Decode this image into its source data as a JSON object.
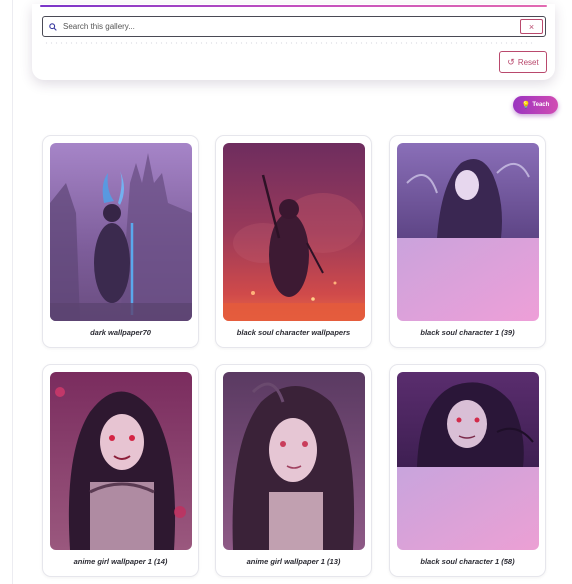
{
  "search": {
    "placeholder": "Search this gallery...",
    "clear_label": "×",
    "reset_label": "Reset"
  },
  "fab": {
    "label": "Teach"
  },
  "gallery": {
    "items": [
      {
        "caption": "dark wallpaper70"
      },
      {
        "caption": "black soul character wallpapers"
      },
      {
        "caption": "black soul character 1 (39)"
      },
      {
        "caption": "anime girl wallpaper 1 (14)"
      },
      {
        "caption": "anime girl wallpaper 1 (13)"
      },
      {
        "caption": "black soul character 1 (58)"
      }
    ]
  },
  "colors": {
    "accent_gradient_start": "#7a35c9",
    "accent_gradient_end": "#e26ab1",
    "button_border": "#b9496d",
    "fab_gradient_start": "#9a33c0",
    "fab_gradient_end": "#d14bb3"
  }
}
